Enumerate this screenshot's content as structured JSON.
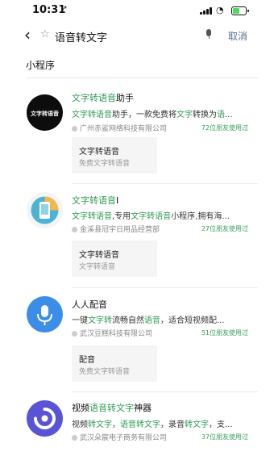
{
  "status_bar": {
    "time": "10:31",
    "location_glyph": "↗"
  },
  "search": {
    "back_glyph": "‹",
    "star_glyph": "☆",
    "query": "语音转文字",
    "cancel_label": "取消"
  },
  "section_title": "小程序",
  "colors": {
    "highlight": "#2f9a56",
    "friends": "#3a9d5d",
    "cancel": "#576b95"
  },
  "results": [
    {
      "title": [
        {
          "t": "文字转语音",
          "h": true
        },
        {
          "t": "助手",
          "h": false
        }
      ],
      "description": [
        {
          "t": "文字转语音",
          "h": true
        },
        {
          "t": "助手，一款免费将",
          "h": false
        },
        {
          "t": "文字",
          "h": true
        },
        {
          "t": "转换为",
          "h": false
        },
        {
          "t": "语",
          "h": true
        },
        {
          "t": "...",
          "h": false
        }
      ],
      "company": "广州赤鲨网络科技有限公司",
      "friends": "72位朋友使用过",
      "sub_item": {
        "title": "文字转语音",
        "subtitle": "免费文字转语音"
      },
      "logo_text": "文字转语音"
    },
    {
      "title": [
        {
          "t": "文字转语音",
          "h": true
        },
        {
          "t": "I",
          "h": false
        }
      ],
      "description": [
        {
          "t": "文字转语音",
          "h": true
        },
        {
          "t": ",专用",
          "h": false
        },
        {
          "t": "文字转语音",
          "h": true
        },
        {
          "t": "小程序,拥有海...",
          "h": false
        }
      ],
      "company": "金溪县冠宇日用品经营部",
      "friends": "27位朋友使用过",
      "sub_item": {
        "title": "文字转语音",
        "subtitle": "文字转语音"
      }
    },
    {
      "title": [
        {
          "t": "人人配音",
          "h": false
        }
      ],
      "description": [
        {
          "t": "一键",
          "h": false
        },
        {
          "t": "文字转",
          "h": true
        },
        {
          "t": "流畅自然",
          "h": false
        },
        {
          "t": "语音",
          "h": true
        },
        {
          "t": "，适合短视频配...",
          "h": false
        }
      ],
      "company": "武汉豆糕科技有限公司",
      "friends": "51位朋友使用过",
      "sub_item": {
        "title": "配音",
        "subtitle": "免费文字转语音"
      }
    },
    {
      "title": [
        {
          "t": "视频",
          "h": false
        },
        {
          "t": "语音转文字",
          "h": true
        },
        {
          "t": "神器",
          "h": false
        }
      ],
      "description": [
        {
          "t": "视频",
          "h": false
        },
        {
          "t": "转文字",
          "h": true
        },
        {
          "t": "，",
          "h": false
        },
        {
          "t": "语音转文字",
          "h": true
        },
        {
          "t": "，录音",
          "h": false
        },
        {
          "t": "转文字",
          "h": true
        },
        {
          "t": "，支...",
          "h": false
        }
      ],
      "company": "武汉朵宸电子商务有限公司",
      "friends": "37位朋友使用过"
    }
  ]
}
